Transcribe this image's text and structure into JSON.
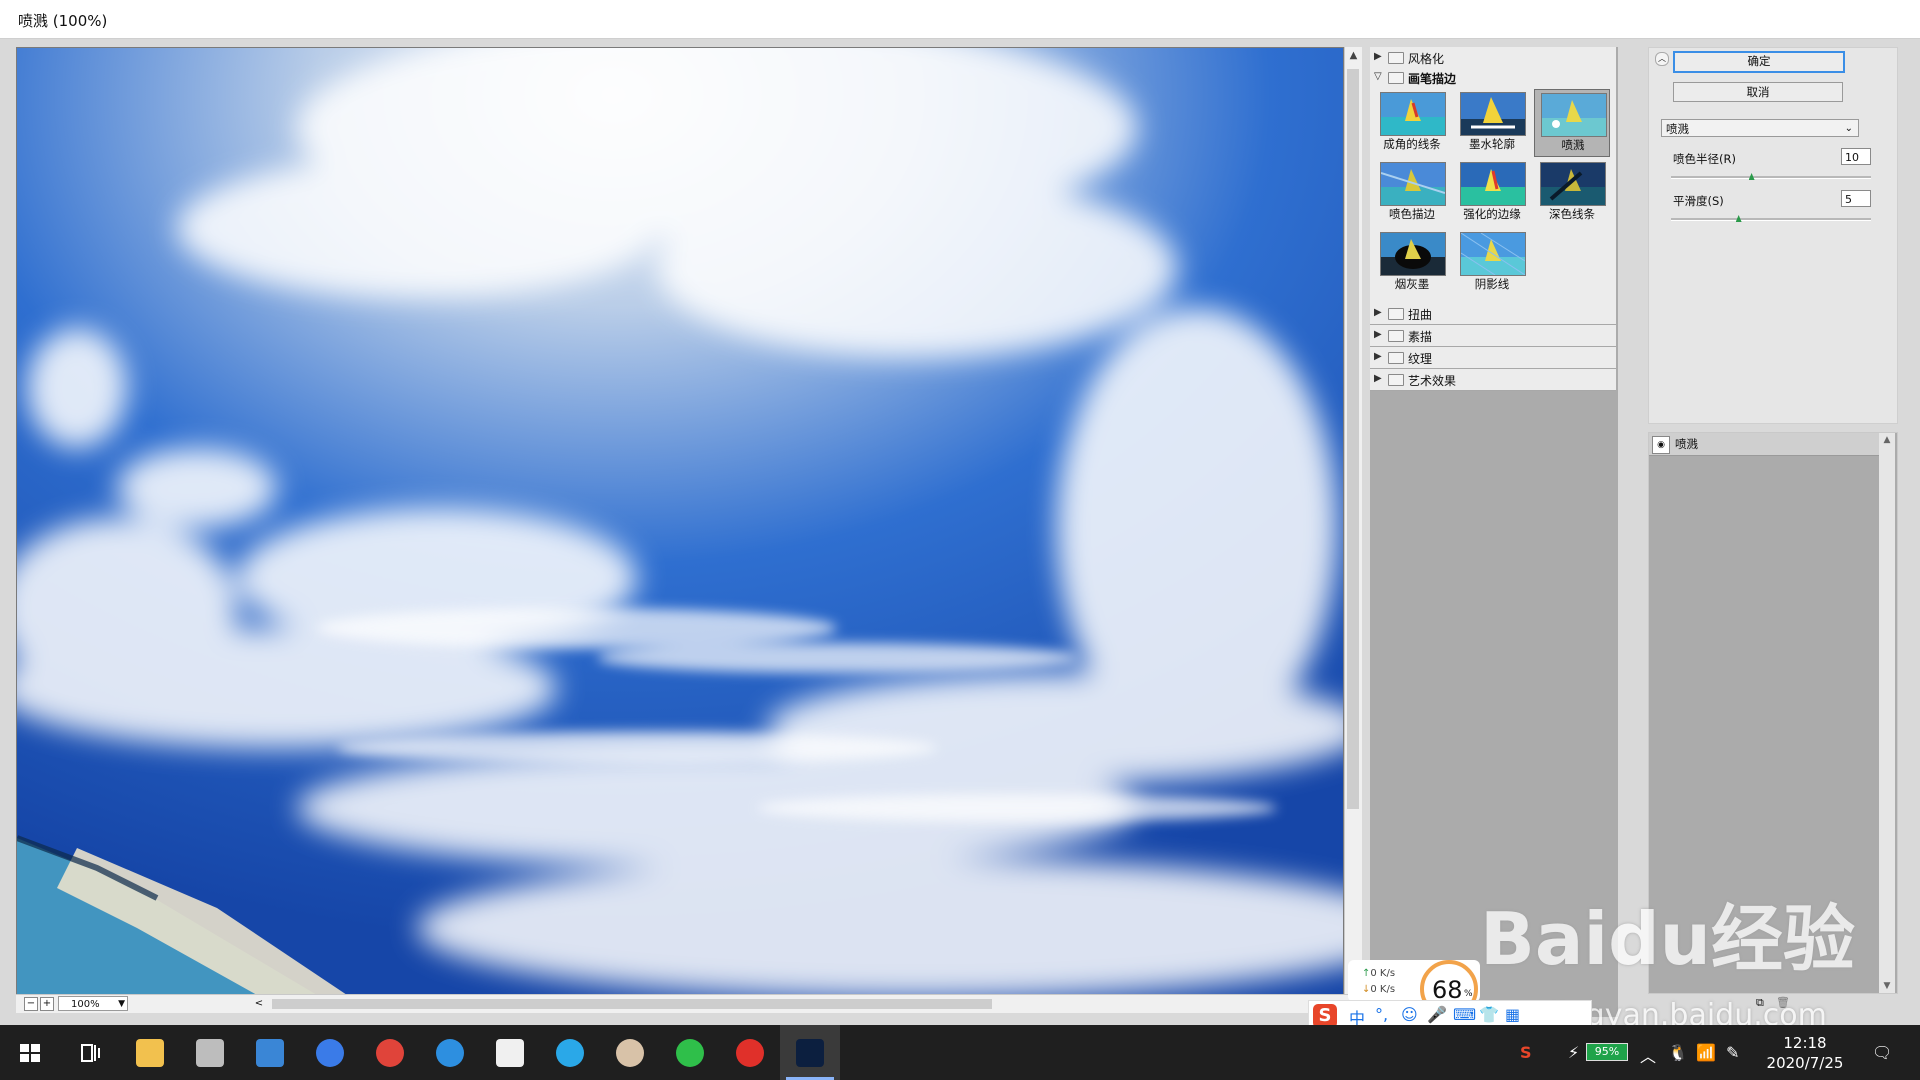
{
  "window": {
    "title": "喷溅 (100%)"
  },
  "preview": {
    "zoom": "100%"
  },
  "gallery": {
    "categories_top": [
      {
        "label": "风格化",
        "expanded": false
      },
      {
        "label": "画笔描边",
        "expanded": true
      }
    ],
    "thumbnails": [
      {
        "label": "成角的线条"
      },
      {
        "label": "墨水轮廓"
      },
      {
        "label": "喷溅",
        "selected": true
      },
      {
        "label": "喷色描边"
      },
      {
        "label": "强化的边缘"
      },
      {
        "label": "深色线条"
      },
      {
        "label": "烟灰墨"
      },
      {
        "label": "阴影线"
      }
    ],
    "categories_bottom": [
      {
        "label": "扭曲"
      },
      {
        "label": "素描"
      },
      {
        "label": "纹理"
      },
      {
        "label": "艺术效果"
      }
    ]
  },
  "settings": {
    "ok_label": "确定",
    "cancel_label": "取消",
    "filter_selected": "喷溅",
    "params": [
      {
        "label": "喷色半径(R)",
        "value": "10",
        "max": 25
      },
      {
        "label": "平滑度(S)",
        "value": "5",
        "max": 15
      }
    ]
  },
  "layers": {
    "items": [
      {
        "label": "喷溅"
      }
    ]
  },
  "net_widget": {
    "up": "0 K/s",
    "down": "0 K/s",
    "percent": "68",
    "percent_sign": "%"
  },
  "ime": {
    "chinese": "中",
    "punct": "°,"
  },
  "watermark": {
    "brand": "Baidu经验",
    "url": "jingyan.baidu.com"
  },
  "taskbar": {
    "apps": [
      {
        "name": "file-explorer",
        "color": "#f2c14e"
      },
      {
        "name": "settings",
        "color": "#bdbdbd"
      },
      {
        "name": "photos",
        "color": "#3a86d6"
      },
      {
        "name": "l-app",
        "color": "#3a7be8"
      },
      {
        "name": "chrome",
        "color": "#e0443a"
      },
      {
        "name": "edge",
        "color": "#2d8fe0"
      },
      {
        "name": "store",
        "color": "#f0f0f0"
      },
      {
        "name": "q-app",
        "color": "#2aa8e8"
      },
      {
        "name": "avatar-app",
        "color": "#d8c2a8"
      },
      {
        "name": "wechat",
        "color": "#2fbf4a"
      },
      {
        "name": "netease-music",
        "color": "#e0302a"
      },
      {
        "name": "photoshop",
        "color": "#0c1f3f",
        "active": true
      }
    ],
    "battery": "95%",
    "time": "12:18",
    "date": "2020/7/25"
  }
}
